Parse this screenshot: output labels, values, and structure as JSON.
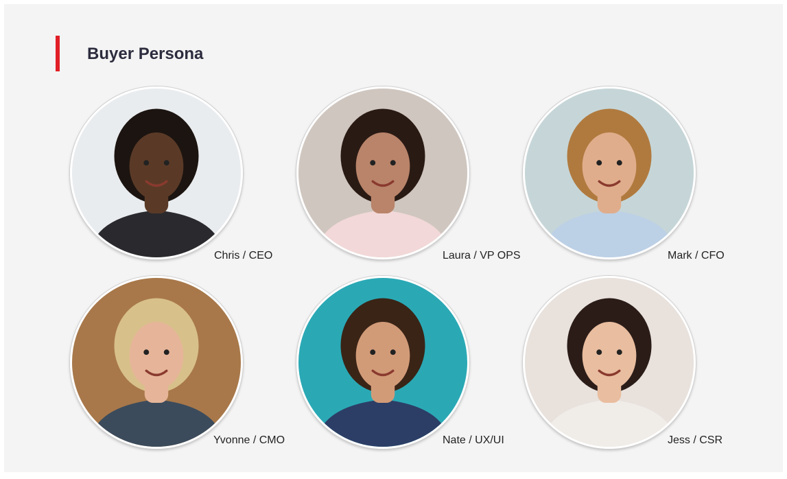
{
  "header": {
    "title": "Buyer Persona",
    "accent_color": "#e11f26"
  },
  "personas": [
    {
      "caption": "Chris / CEO",
      "bg": "#e9ecef",
      "skin": "#5a3a27",
      "hair": "#1c1410",
      "shirt": "#2a2a2e"
    },
    {
      "caption": "Laura / VP OPS",
      "bg": "#cfc6bf",
      "skin": "#b9846a",
      "hair": "#2a1a14",
      "shirt": "#f2d8d8"
    },
    {
      "caption": "Mark / CFO",
      "bg": "#c6d6d8",
      "skin": "#e0ad8c",
      "hair": "#b07a3f",
      "shirt": "#bcd0e6"
    },
    {
      "caption": "Yvonne / CMO",
      "bg": "#a8784a",
      "skin": "#e6b599",
      "hair": "#d8c08a",
      "shirt": "#3b4b5c"
    },
    {
      "caption": "Nate / UX/UI",
      "bg": "#2aa9b5",
      "skin": "#d29b78",
      "hair": "#3a2416",
      "shirt": "#2c3e66"
    },
    {
      "caption": "Jess / CSR",
      "bg": "#e8e1dc",
      "skin": "#e9bd9f",
      "hair": "#2b1c18",
      "shirt": "#f0ece8"
    }
  ]
}
